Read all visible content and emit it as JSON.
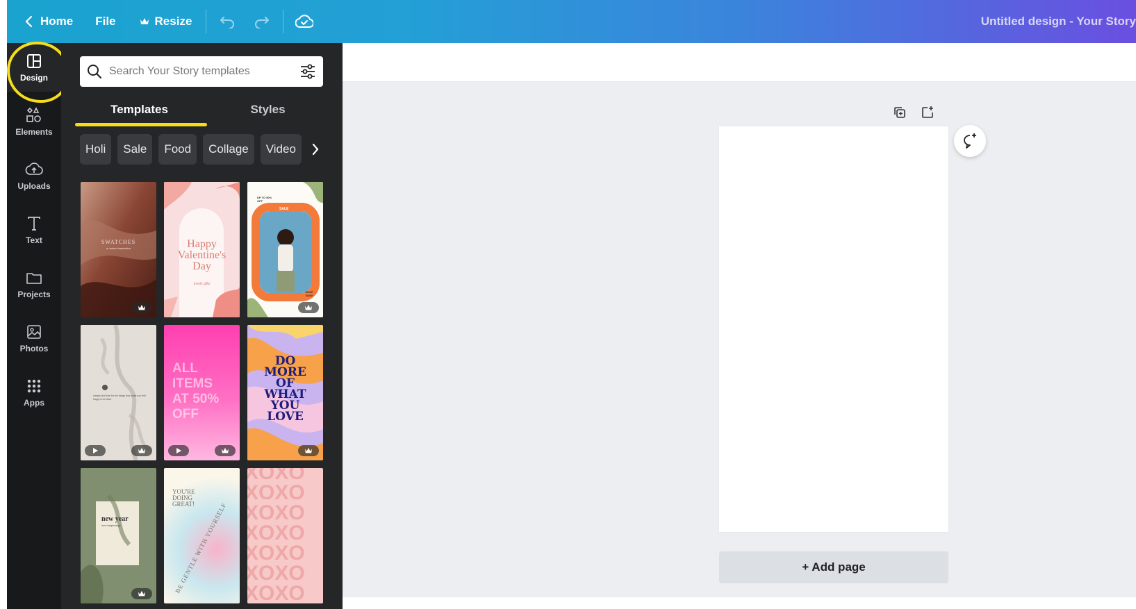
{
  "topbar": {
    "home_label": "Home",
    "file_label": "File",
    "resize_label": "Resize",
    "title": "Untitled design - Your Story"
  },
  "rail": {
    "items": [
      {
        "label": "Design",
        "icon": "layout-icon"
      },
      {
        "label": "Elements",
        "icon": "shapes-icon"
      },
      {
        "label": "Uploads",
        "icon": "cloud-upload-icon"
      },
      {
        "label": "Text",
        "icon": "text-icon"
      },
      {
        "label": "Projects",
        "icon": "folder-icon"
      },
      {
        "label": "Photos",
        "icon": "image-icon"
      },
      {
        "label": "Apps",
        "icon": "apps-grid-icon"
      }
    ]
  },
  "panel": {
    "search_placeholder": "Search Your Story templates",
    "tabs": [
      "Templates",
      "Styles"
    ],
    "chips": [
      "Holi",
      "Sale",
      "Food",
      "Collage",
      "Video"
    ],
    "templates": {
      "t1_title": "SWATCHES",
      "t1_sub": "a natural inspiration",
      "t2_title_1": "Happy",
      "t2_title_2": "Valentine's",
      "t2_title_3": "Day",
      "t2_sub": "lovely gifts",
      "t3_top": "UP TO 50% OFF",
      "t3_sale": "SALE",
      "t3_shop": "SHOP NOW",
      "t4_text": "always find time for the things that make you feel happy to be alive",
      "t5_lines": [
        "ALL",
        "ITEMS",
        "AT 50%",
        "OFF"
      ],
      "t6_lines": [
        "DO",
        "MORE",
        "OF",
        "WHAT",
        "YOU",
        "LOVE"
      ],
      "t7_title": "new year",
      "t7_sub": "new beginnings",
      "t8_top": "YOU'RE DOING GREAT!",
      "t8_arc": "BE GENTLE WITH YOURSELF",
      "t9_text": "XOXO"
    }
  },
  "canvas": {
    "add_page_label": "+ Add page"
  },
  "colors": {
    "accent_yellow": "#f6dd1b",
    "rail_bg": "#18191b",
    "panel_bg": "#252627",
    "canvas_bg": "#eceef1"
  }
}
